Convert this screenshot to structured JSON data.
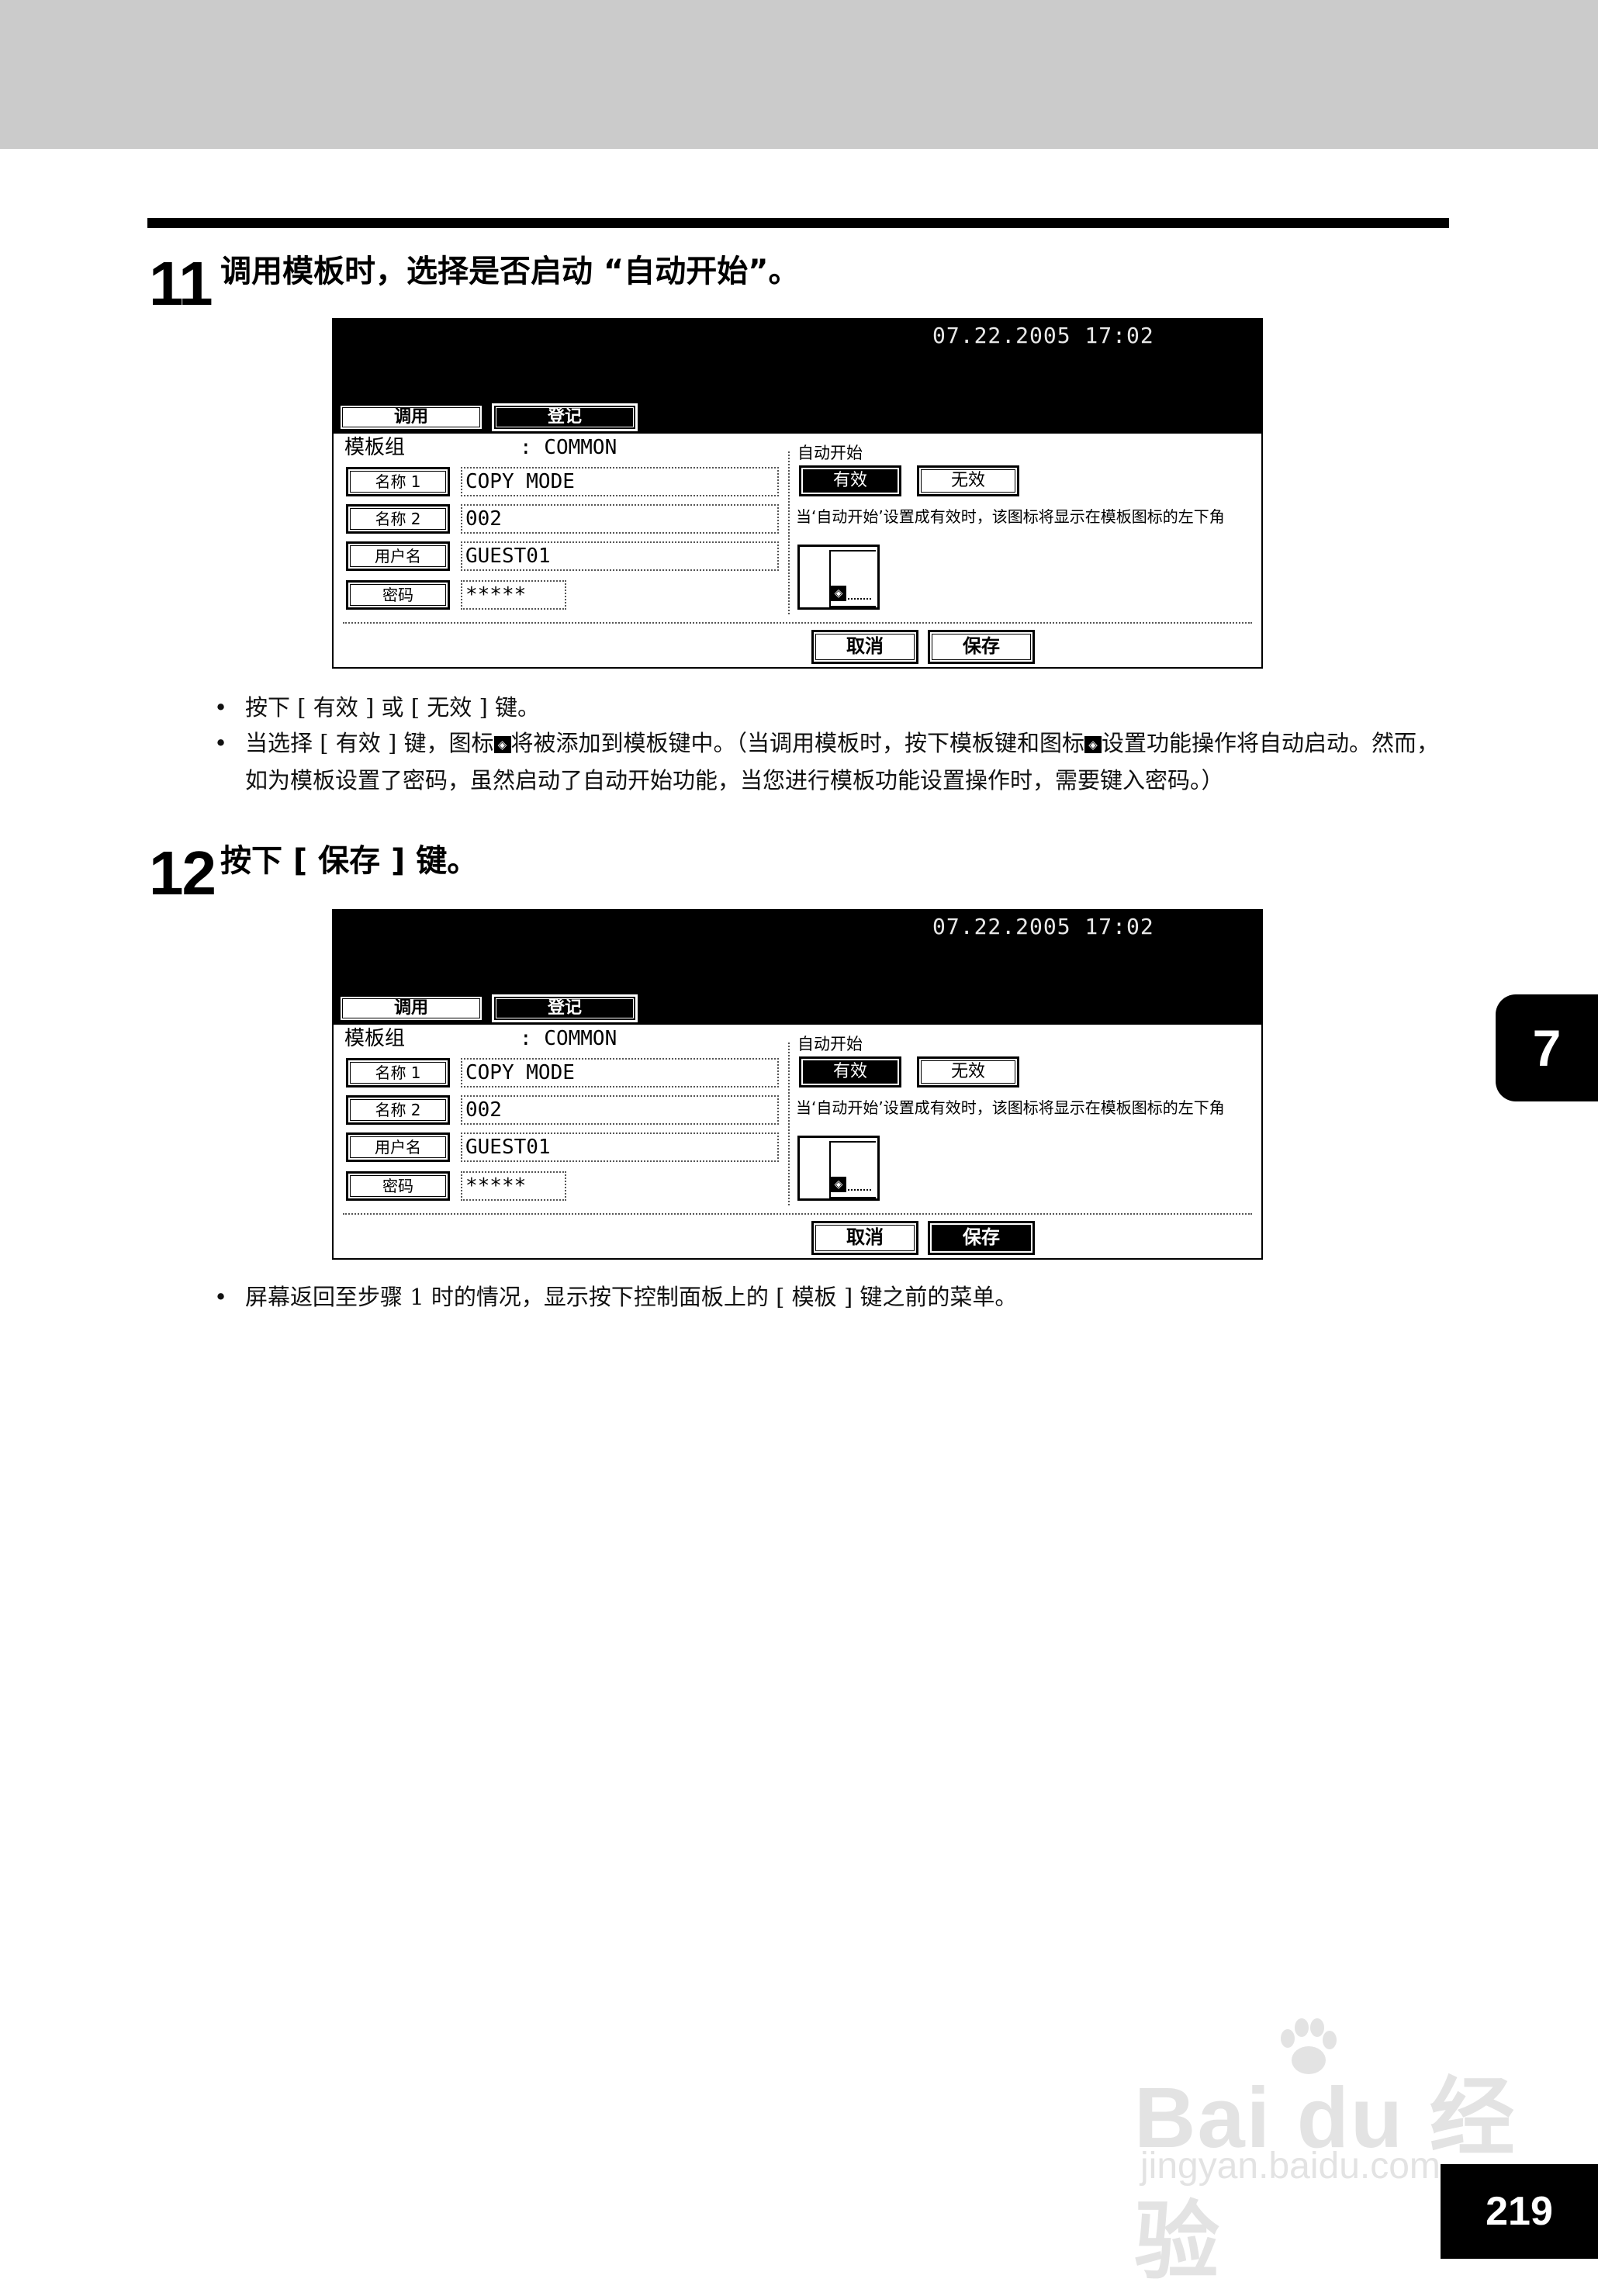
{
  "step11": {
    "number": "11",
    "title": "调用模板时，选择是否启动 “自动开始”。"
  },
  "step12": {
    "number": "12",
    "title": "按下 [ 保存 ] 键。"
  },
  "screen": {
    "datetime": "07.22.2005 17:02",
    "tab_call": "调用",
    "tab_register": "登记",
    "group_label": "模板组",
    "group_value": ": COMMON",
    "name1_button": "名称 1",
    "name1_value": "COPY MODE",
    "name2_button": "名称 2",
    "name2_value": "002",
    "username_button": "用户名",
    "username_value": "GUEST01",
    "password_button": "密码",
    "password_value": "*****",
    "auto_start_label": "自动开始",
    "valid_button": "有效",
    "invalid_button": "无效",
    "note": "当‘自动开始’设置成有效时，该图标将显示在模板图标的左下角",
    "cancel_button": "取消",
    "save_button": "保存"
  },
  "bullets11": [
    "按下 [ 有效 ] 或 [ 无效 ] 键。",
    "当选择 [ 有效 ] 键，图标",
    "将被添加到模板键中。（当调用模板时，按下模板键和图标",
    "设置功能操作将自动启动。然而，如为模板设置了密码，虽然启动了自动开始功能，当您进行模板功能设置操作时，需要键入密码。）"
  ],
  "bullets12": [
    "屏幕返回至步骤 1 时的情况，显示按下控制面板上的 [ 模板 ] 键之前的菜单。"
  ],
  "bullet_mark": "•",
  "icon_glyph": "◈",
  "chapter_tab": "7",
  "page_number": "219",
  "watermark": {
    "brand": "Bai du 经验",
    "url": "jingyan.baidu.com"
  }
}
